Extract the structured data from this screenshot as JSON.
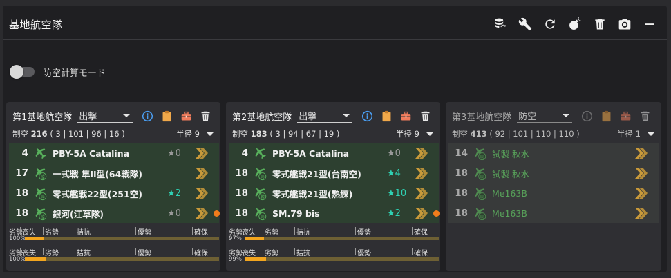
{
  "panel": {
    "title": "基地航空隊",
    "toolbar": [
      {
        "name": "database-sync-icon"
      },
      {
        "name": "wrench-icon"
      },
      {
        "name": "refresh-icon"
      },
      {
        "name": "bomb-icon"
      },
      {
        "name": "trash-icon"
      },
      {
        "name": "camera-icon"
      },
      {
        "name": "minimize-icon"
      }
    ]
  },
  "toggle": {
    "label": "防空計算モード",
    "on": false
  },
  "corps": [
    {
      "name": "第1基地航空隊",
      "mode": "出撃",
      "air_label": "制空",
      "air_value": "216",
      "air_detail": "( 3 | 101 | 96 | 16 )",
      "radius": "半径 9",
      "slots": [
        {
          "count": "4",
          "icon": "seaplane-icon",
          "name": "PBY-5A Catalina",
          "star": "★0",
          "star_color": "grey",
          "dot": false
        },
        {
          "count": "17",
          "icon": "army-fighter-icon",
          "name": "一式戦 隼II型(64戦隊)",
          "star": "",
          "star_color": "",
          "dot": false
        },
        {
          "count": "18",
          "icon": "carrier-fighter-icon",
          "name": "零式艦戦22型(251空)",
          "star": "★2",
          "star_color": "teal",
          "dot": false
        },
        {
          "count": "18",
          "icon": "land-attacker-icon",
          "name": "銀河(江草隊)",
          "star": "★0",
          "star_color": "grey",
          "dot": true
        }
      ],
      "gauges": [
        {
          "labels": [
            "劣勢",
            "喪失",
            "劣勢",
            "拮抗",
            "優勢",
            "確保"
          ],
          "pct": "100%",
          "fill": 0.1
        },
        {
          "labels": [
            "劣勢",
            "喪失",
            "劣勢",
            "拮抗",
            "優勢",
            "確保"
          ],
          "pct": "100%",
          "fill": 0.11
        }
      ]
    },
    {
      "name": "第2基地航空隊",
      "mode": "出撃",
      "air_label": "制空",
      "air_value": "183",
      "air_detail": "( 3 | 94 | 67 | 19 )",
      "radius": "半径 9",
      "slots": [
        {
          "count": "4",
          "icon": "seaplane-icon",
          "name": "PBY-5A Catalina",
          "star": "★0",
          "star_color": "grey",
          "dot": false
        },
        {
          "count": "18",
          "icon": "carrier-fighter-icon",
          "name": "零式艦戦21型(台南空)",
          "star": "★4",
          "star_color": "teal",
          "dot": false
        },
        {
          "count": "18",
          "icon": "fighter-bomber-icon",
          "name": "零式艦戦21型(熟練)",
          "star": "★10",
          "star_color": "teal",
          "dot": false
        },
        {
          "count": "18",
          "icon": "carrier-fighter-icon",
          "name": "SM.79 bis",
          "star": "★2",
          "star_color": "teal",
          "dot": true
        }
      ],
      "gauges": [
        {
          "labels": [
            "劣勢",
            "喪失",
            "劣勢",
            "拮抗",
            "優勢",
            "確保"
          ],
          "pct": "97%",
          "fill": 0.1
        },
        {
          "labels": [
            "劣勢",
            "喪失",
            "劣勢",
            "拮抗",
            "優勢",
            "確保"
          ],
          "pct": "99%",
          "fill": 0.11
        }
      ]
    },
    {
      "name": "第3基地航空隊",
      "mode": "防空",
      "air_label": "制空",
      "air_value": "413",
      "air_detail": "( 92 | 101 | 110 | 110 )",
      "radius": "半径 1",
      "slots": [
        {
          "count": "14",
          "icon": "carrier-fighter-icon",
          "name": "試製 秋水",
          "star": "",
          "star_color": "",
          "dot": false
        },
        {
          "count": "18",
          "icon": "carrier-fighter-icon",
          "name": "試製 秋水",
          "star": "",
          "star_color": "",
          "dot": false
        },
        {
          "count": "18",
          "icon": "carrier-fighter-icon",
          "name": "Me163B",
          "star": "",
          "star_color": "",
          "dot": false
        },
        {
          "count": "18",
          "icon": "carrier-fighter-icon",
          "name": "Me163B",
          "star": "",
          "star_color": "",
          "dot": false
        }
      ],
      "gauges": []
    }
  ],
  "colors": {
    "accent": "#f2a51e",
    "teal_star": "#2fd2b4",
    "dot": "#f07c1c",
    "info": "#4a9df0",
    "clipboard": "#f0a84a",
    "briefcase": "#f07c5c"
  }
}
